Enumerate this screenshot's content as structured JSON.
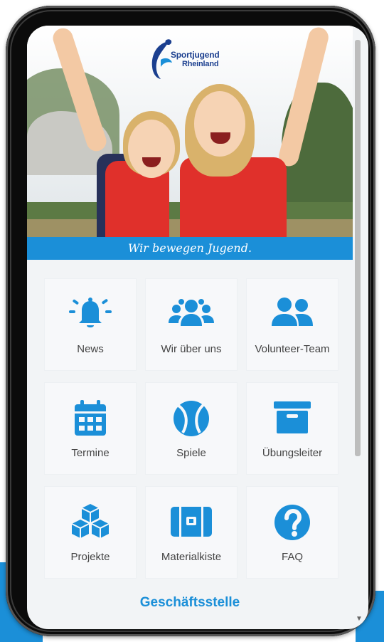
{
  "hero": {
    "logo_line1": "Sportjugend",
    "logo_line2": "Rheinland",
    "slogan": "Wir bewegen Jugend."
  },
  "menu": [
    {
      "label": "News",
      "icon": "bell-icon"
    },
    {
      "label": "Wir über uns",
      "icon": "users-group-icon"
    },
    {
      "label": "Volunteer-Team",
      "icon": "user-pair-icon"
    },
    {
      "label": "Termine",
      "icon": "calendar-icon"
    },
    {
      "label": "Spiele",
      "icon": "ball-icon"
    },
    {
      "label": "Übungsleiter",
      "icon": "archive-box-icon"
    },
    {
      "label": "Projekte",
      "icon": "cubes-icon"
    },
    {
      "label": "Materialkiste",
      "icon": "toolbox-icon"
    },
    {
      "label": "FAQ",
      "icon": "question-circle-icon"
    }
  ],
  "footer": {
    "link": "Geschäftsstelle"
  },
  "colors": {
    "accent": "#1b8fd8",
    "text": "#444444",
    "tile_bg": "#f7f8fa"
  }
}
